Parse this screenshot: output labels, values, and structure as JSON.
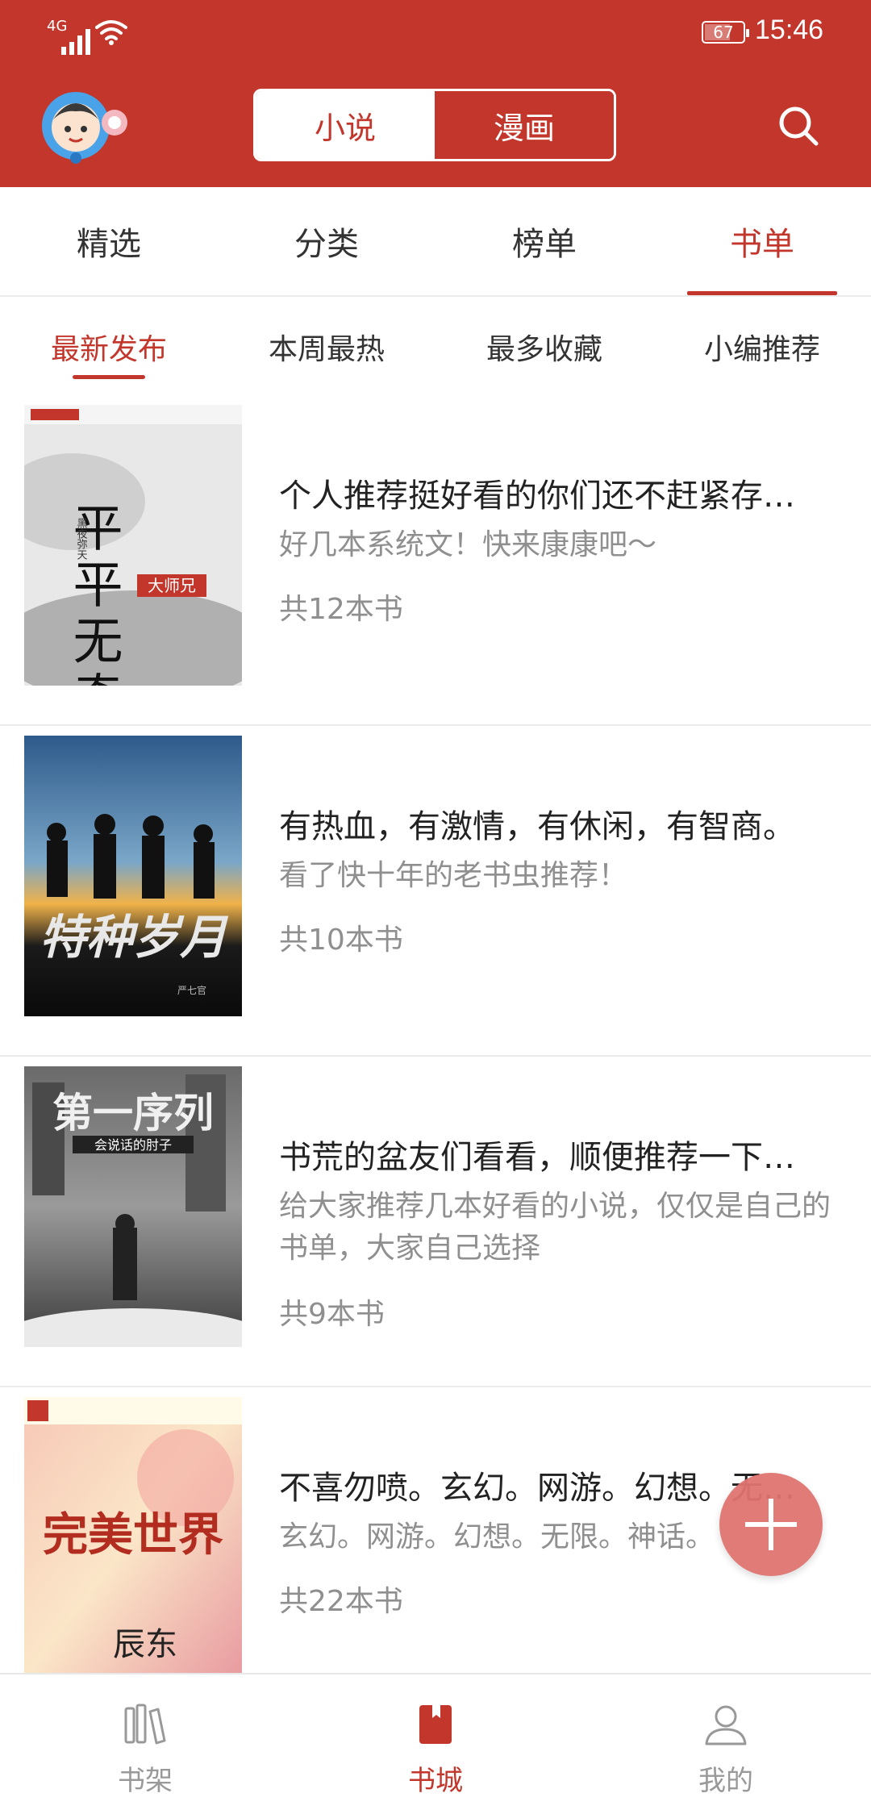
{
  "status_bar": {
    "network": "4G",
    "battery": "67",
    "time": "15:46"
  },
  "header": {
    "segments": [
      "小说",
      "漫画"
    ],
    "active_segment": "小说"
  },
  "tabs": [
    "精选",
    "分类",
    "榜单",
    "书单"
  ],
  "active_tab": "书单",
  "sub_tabs": [
    "最新发布",
    "本周最热",
    "最多收藏",
    "小编推荐"
  ],
  "active_sub_tab": "最新发布",
  "booklists": [
    {
      "title": "个人推荐挺好看的你们还不赶紧存…",
      "description": "好几本系统文！快来康康吧～",
      "count": "共12本书",
      "cover_text": "平平无奇",
      "cover_label": "大师兄",
      "cover_author": "黑夜弥天"
    },
    {
      "title": "有热血，有激情，有休闲，有智商。",
      "description": "看了快十年的老书虫推荐！",
      "count": "共10本书",
      "cover_text": "特种岁月",
      "cover_author": "严七官"
    },
    {
      "title": "书荒的盆友们看看，顺便推荐一下…",
      "description": "给大家推荐几本好看的小说，仅仅是自己的书单，大家自己选择",
      "count": "共9本书",
      "cover_text": "第一序列",
      "cover_author": "会说话的肘子"
    },
    {
      "title": "不喜勿喷。玄幻。网游。幻想。无…",
      "description": "玄幻。网游。幻想。无限。神话。",
      "count": "共22本书",
      "cover_text": "完美世界",
      "cover_author": "辰东"
    }
  ],
  "bottom_nav": [
    {
      "label": "书架",
      "icon": "bookshelf-icon"
    },
    {
      "label": "书城",
      "icon": "bookstore-icon"
    },
    {
      "label": "我的",
      "icon": "profile-icon"
    }
  ],
  "active_nav": "书城",
  "colors": {
    "brand": "#c3362b",
    "fab": "#e07470",
    "muted_text": "#8f8f8f"
  }
}
